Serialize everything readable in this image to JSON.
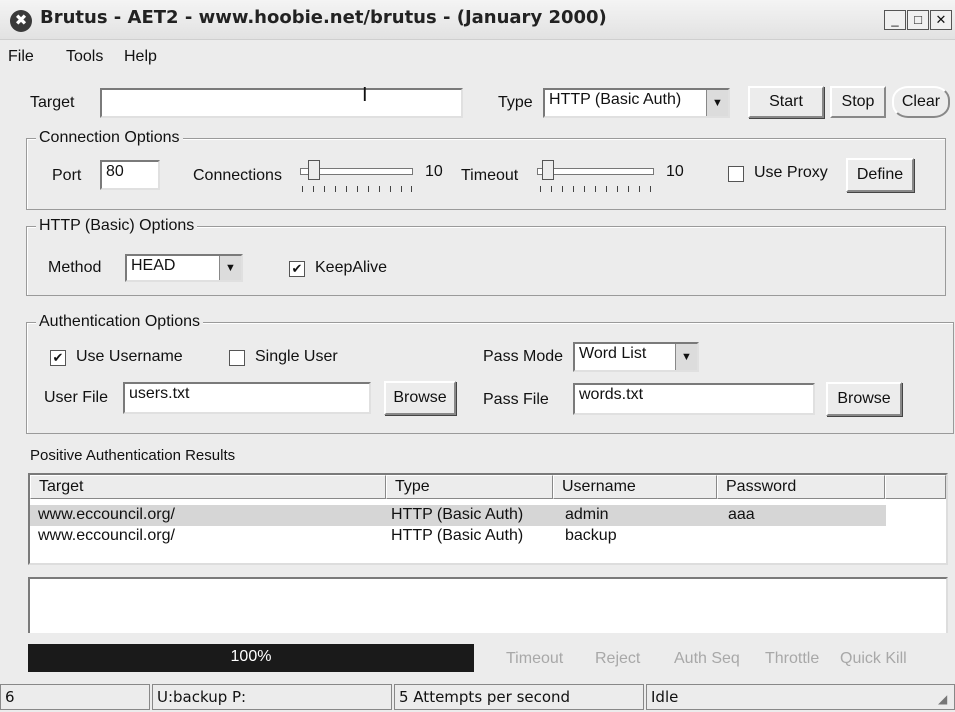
{
  "window": {
    "title": "Brutus - AET2 - www.hoobie.net/brutus - (January 2000)",
    "app_icon_glyph": "✖",
    "minimize_glyph": "_",
    "maximize_glyph": "□",
    "close_glyph": "✕"
  },
  "menu": [
    "File",
    "Tools",
    "Help"
  ],
  "target": {
    "label": "Target",
    "value": "",
    "type_label": "Type",
    "type_value": "HTTP (Basic Auth)",
    "start_label": "Start",
    "stop_label": "Stop",
    "clear_label": "Clear"
  },
  "connection_options": {
    "title": "Connection Options",
    "port_label": "Port",
    "port_value": "80",
    "connections_label": "Connections",
    "connections_value": "10",
    "timeout_label": "Timeout",
    "timeout_value": "10",
    "use_proxy_label": "Use Proxy",
    "use_proxy_checked": false,
    "define_label": "Define"
  },
  "http_options": {
    "title": "HTTP (Basic) Options",
    "method_label": "Method",
    "method_value": "HEAD",
    "keepalive_label": "KeepAlive",
    "keepalive_checked": true
  },
  "auth_options": {
    "title": "Authentication Options",
    "use_username_label": "Use Username",
    "use_username_checked": true,
    "single_user_label": "Single User",
    "single_user_checked": false,
    "pass_mode_label": "Pass Mode",
    "pass_mode_value": "Word List",
    "user_file_label": "User File",
    "user_file_value": "users.txt",
    "browse_user_label": "Browse",
    "pass_file_label": "Pass File",
    "pass_file_value": "words.txt",
    "browse_pass_label": "Browse"
  },
  "results": {
    "title": "Positive Authentication Results",
    "columns": [
      "Target",
      "Type",
      "Username",
      "Password"
    ],
    "rows": [
      [
        "www.eccouncil.org/",
        "HTTP (Basic Auth)",
        "admin",
        "aaa"
      ],
      [
        "www.eccouncil.org/",
        "HTTP (Basic Auth)",
        "backup",
        ""
      ]
    ]
  },
  "log": {
    "text": ""
  },
  "progress": {
    "percent_text": "100%",
    "fraction": 1.0,
    "indicators": [
      "Timeout",
      "Reject",
      "Auth Seq",
      "Throttle",
      "Quick Kill"
    ]
  },
  "status": {
    "count": "6",
    "current": "U:backup  P:",
    "rate": "5 Attempts per second",
    "state": "Idle"
  },
  "colors": {
    "window_bg": "#ececec",
    "progress_bar": "#1a1a1a",
    "selected_row": "#d6d6d6",
    "indicator_inactive": "#a8a8a8"
  }
}
